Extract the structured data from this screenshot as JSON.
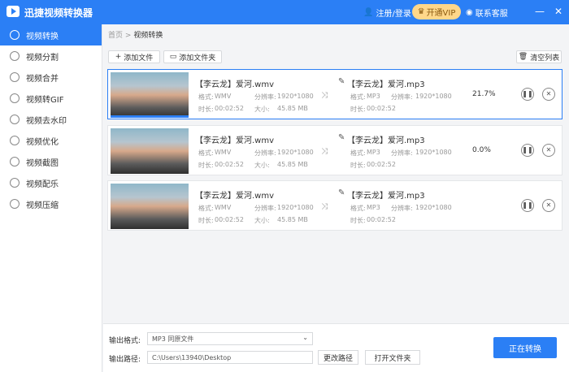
{
  "app": {
    "title": "迅捷视频转换器",
    "login": "注册/登录",
    "vip": "开通VIP",
    "service": "联系客服"
  },
  "sidebar": {
    "items": [
      {
        "label": "视频转换",
        "icon": "convert-icon"
      },
      {
        "label": "视频分割",
        "icon": "split-icon"
      },
      {
        "label": "视频合并",
        "icon": "merge-icon"
      },
      {
        "label": "视频转GIF",
        "icon": "gif-icon"
      },
      {
        "label": "视频去水印",
        "icon": "watermark-icon"
      },
      {
        "label": "视频优化",
        "icon": "optimize-icon"
      },
      {
        "label": "视频截图",
        "icon": "screenshot-icon"
      },
      {
        "label": "视频配乐",
        "icon": "music-icon"
      },
      {
        "label": "视频压缩",
        "icon": "compress-icon"
      }
    ]
  },
  "breadcrumb": {
    "home": "首页",
    "sep": ">",
    "current": "视频转换"
  },
  "toolbar": {
    "add_file": "添加文件",
    "add_folder": "添加文件夹",
    "clear_list": "清空列表"
  },
  "rows": [
    {
      "src_name": "【李云龙】爱河.wmv",
      "format_label": "格式:",
      "format": "WMV",
      "res_label": "分辨率:",
      "res": "1920*1080",
      "dur_label": "时长:",
      "duration": "00:02:52",
      "size_label": "大小:",
      "size": "45.85 MB",
      "out_name": "【李云龙】爱河.mp3",
      "out_format": "MP3",
      "out_res": "1920*1080",
      "out_duration": "00:02:52",
      "progress": "21.7%"
    },
    {
      "src_name": "【李云龙】爱河.wmv",
      "format_label": "格式:",
      "format": "WMV",
      "res_label": "分辨率:",
      "res": "1920*1080",
      "dur_label": "时长:",
      "duration": "00:02:52",
      "size_label": "大小:",
      "size": "45.85 MB",
      "out_name": "【李云龙】爱河.mp3",
      "out_format": "MP3",
      "out_res": "1920*1080",
      "out_duration": "00:02:52",
      "progress": "0.0%"
    },
    {
      "src_name": "【李云龙】爱河.wmv",
      "format_label": "格式:",
      "format": "WMV",
      "res_label": "分辨率:",
      "res": "1920*1080",
      "dur_label": "时长:",
      "duration": "00:02:52",
      "size_label": "大小:",
      "size": "45.85 MB",
      "out_name": "【李云龙】爱河.mp3",
      "out_format": "MP3",
      "out_res": "1920*1080",
      "out_duration": "00:02:52",
      "progress": ""
    }
  ],
  "bottom": {
    "format_label": "输出格式:",
    "format_value": "MP3 同原文件",
    "path_label": "输出路径:",
    "path_value": "C:\\Users\\13940\\Desktop",
    "change_path": "更改路径",
    "open_folder": "打开文件夹",
    "convert": "正在转换"
  },
  "colors": {
    "accent": "#2b7ff5"
  }
}
